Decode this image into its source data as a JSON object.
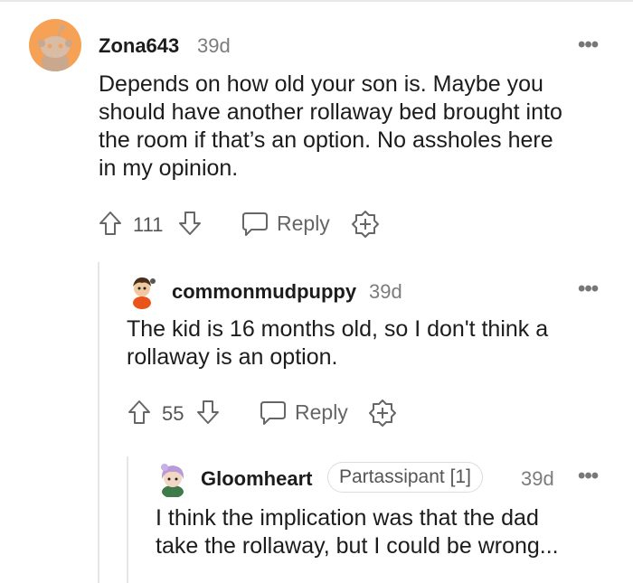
{
  "comments": [
    {
      "author": "Zona643",
      "time": "39d",
      "body_lines": [
        "Depends on how old your son is. Maybe you",
        "should have another rollaway bed brought into",
        "the room if that’s an option. No assholes here",
        "in my opinion."
      ],
      "votes": "111",
      "reply_label": "Reply",
      "avatar_color": "#f5a257"
    },
    {
      "author": "commonmudpuppy",
      "time": "39d",
      "body_lines": [
        "The kid is 16 months old, so I don't think a",
        "rollaway is an option."
      ],
      "votes": "55",
      "reply_label": "Reply"
    },
    {
      "author": "Gloomheart",
      "flair": "Partassipant [1]",
      "time": "39d",
      "body_lines": [
        "I think the implication was that the dad",
        "take the rollaway, but I could be wrong..."
      ]
    }
  ],
  "icons": [
    "more-options-icon",
    "upvote-icon",
    "downvote-icon",
    "reply-icon",
    "award-icon"
  ]
}
